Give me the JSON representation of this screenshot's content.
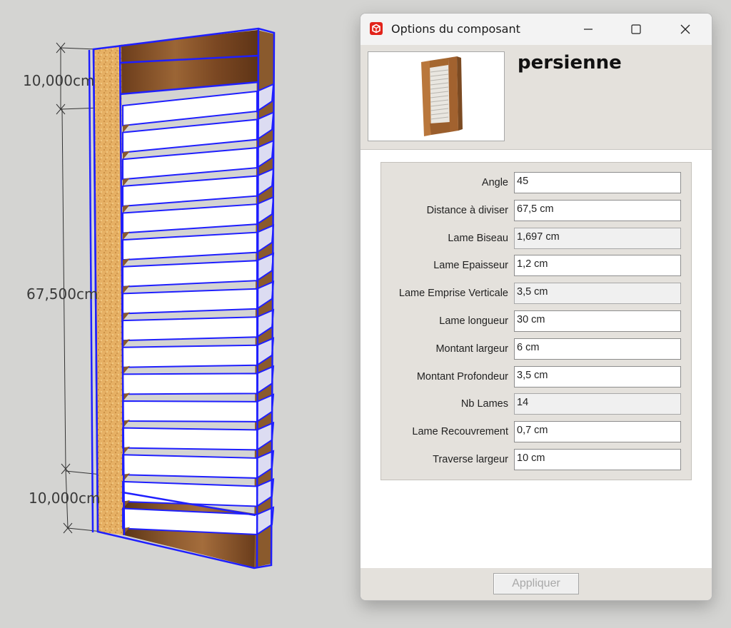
{
  "viewport": {
    "dimensions": [
      "10,000cm",
      "67,500cm",
      "10,000cm"
    ]
  },
  "dialog": {
    "title": "Options du composant",
    "component_name": "persienne",
    "attributes": [
      {
        "label": "Angle",
        "value": "45",
        "readonly": false
      },
      {
        "label": "Distance à diviser",
        "value": "67,5 cm",
        "readonly": false
      },
      {
        "label": "Lame Biseau",
        "value": "1,697 cm",
        "readonly": true
      },
      {
        "label": "Lame Epaisseur",
        "value": "1,2 cm",
        "readonly": false
      },
      {
        "label": "Lame Emprise Verticale",
        "value": "3,5 cm",
        "readonly": true
      },
      {
        "label": "Lame longueur",
        "value": "30 cm",
        "readonly": false
      },
      {
        "label": "Montant largeur",
        "value": "6 cm",
        "readonly": false
      },
      {
        "label": "Montant Profondeur",
        "value": "3,5 cm",
        "readonly": false
      },
      {
        "label": "Nb Lames",
        "value": "14",
        "readonly": true
      },
      {
        "label": "Lame Recouvrement",
        "value": "0,7 cm",
        "readonly": false
      },
      {
        "label": "Traverse largeur",
        "value": "10 cm",
        "readonly": false
      }
    ],
    "apply_label": "Appliquer"
  },
  "colors": {
    "selection": "#1f1fff",
    "wood": "#7a4a22",
    "cork": "#e8b467",
    "dialog_bg": "#e4e1dc"
  },
  "icons": {
    "app": "sketchup-icon",
    "minimize": "minimize-icon",
    "maximize": "maximize-icon",
    "close": "close-icon"
  }
}
